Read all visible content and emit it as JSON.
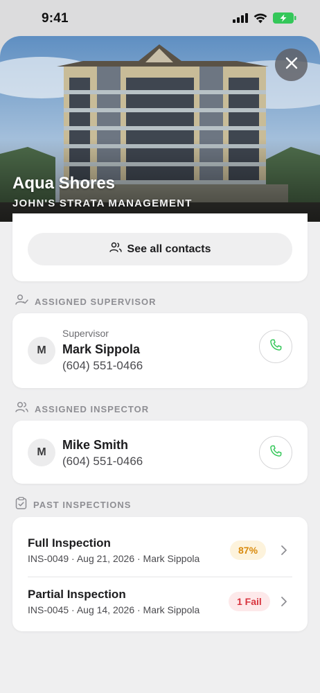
{
  "status_bar": {
    "time": "9:41"
  },
  "property": {
    "name": "Aqua Shores",
    "management": "JOHN'S STRATA MANAGEMENT"
  },
  "contacts": {
    "button_label": "See all contacts"
  },
  "supervisor_section": {
    "header": "ASSIGNED SUPERVISOR",
    "avatar_initial": "M",
    "role": "Supervisor",
    "name": "Mark Sippola",
    "phone": "(604) 551-0466"
  },
  "inspector_section": {
    "header": "ASSIGNED INSPECTOR",
    "avatar_initial": "M",
    "name": "Mike Smith",
    "phone": "(604) 551-0466"
  },
  "past_inspections": {
    "header": "PAST INSPECTIONS",
    "items": [
      {
        "title": "Full Inspection",
        "meta": "INS-0049 · Aug 21, 2026 · Mark Sippola",
        "badge": "87%",
        "badge_type": "score"
      },
      {
        "title": "Partial Inspection",
        "meta": "INS-0045 · Aug 14, 2026 · Mark Sippola",
        "badge": "1 Fail",
        "badge_type": "fail"
      }
    ]
  },
  "colors": {
    "call_green": "#34c759",
    "score_orange": "#d98a0c",
    "fail_red": "#d8343e",
    "battery_green": "#34c759"
  },
  "icons": [
    "signal-icon",
    "wifi-icon",
    "battery-charging-icon",
    "close-icon",
    "contacts-icon",
    "supervisor-icon",
    "phone-icon",
    "inspector-icon",
    "clipboard-icon",
    "chevron-right-icon"
  ]
}
